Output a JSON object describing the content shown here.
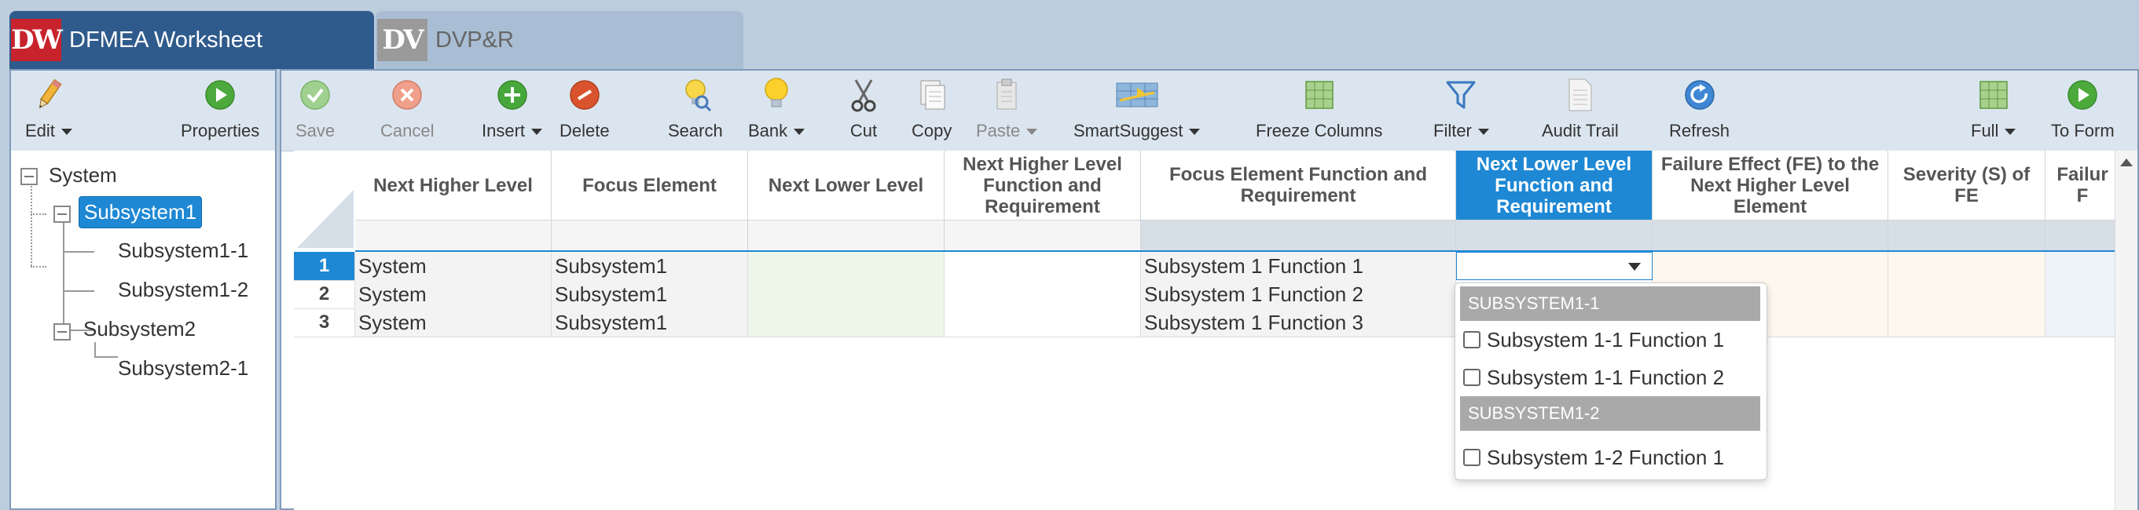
{
  "tabs": [
    {
      "logo": "DW",
      "label": "DFMEA Worksheet",
      "active": true
    },
    {
      "logo": "DV",
      "label": "DVP&R",
      "active": false
    }
  ],
  "left_toolbar": {
    "edit_label": "Edit",
    "properties_label": "Properties"
  },
  "tree": {
    "root": "System",
    "subsystem1": "Subsystem1",
    "subsystem1_1": "Subsystem1-1",
    "subsystem1_2": "Subsystem1-2",
    "subsystem2": "Subsystem2",
    "subsystem2_1": "Subsystem2-1"
  },
  "toolbar": {
    "save": "Save",
    "cancel": "Cancel",
    "insert": "Insert",
    "delete": "Delete",
    "search": "Search",
    "bank": "Bank",
    "cut": "Cut",
    "copy": "Copy",
    "paste": "Paste",
    "smartsuggest": "SmartSuggest",
    "freeze_columns": "Freeze Columns",
    "filter": "Filter",
    "audit_trail": "Audit Trail",
    "refresh": "Refresh",
    "full": "Full",
    "to_form": "To Form"
  },
  "grid": {
    "headers": {
      "next_higher_level": "Next Higher Level",
      "focus_element": "Focus Element",
      "next_lower_level": "Next Lower Level",
      "nhl_function": "Next Higher Level Function and Requirement",
      "fe_function": "Focus Element Function and Requirement",
      "nll_function": "Next Lower Level Function and Requirement",
      "failure_effect": "Failure Effect (FE) to the Next Higher Level Element",
      "severity": "Severity (S) of FE",
      "failure_partial": "Failur F"
    },
    "rows": [
      {
        "num": "1",
        "nhl": "System",
        "focus": "Subsystem1",
        "fe_function": "Subsystem 1 Function 1"
      },
      {
        "num": "2",
        "nhl": "System",
        "focus": "Subsystem1",
        "fe_function": "Subsystem 1 Function 2"
      },
      {
        "num": "3",
        "nhl": "System",
        "focus": "Subsystem1",
        "fe_function": "Subsystem 1 Function 3"
      }
    ]
  },
  "dropdown": {
    "group1": "SUBSYSTEM1-1",
    "item1": "Subsystem 1-1 Function 1",
    "item2": "Subsystem 1-1 Function 2",
    "group2": "SUBSYSTEM1-2",
    "item3": "Subsystem 1-2 Function 1"
  },
  "colors": {
    "accent": "#1e88d4",
    "active_tab": "#2f5a8c",
    "logo_red": "#c8232c"
  }
}
